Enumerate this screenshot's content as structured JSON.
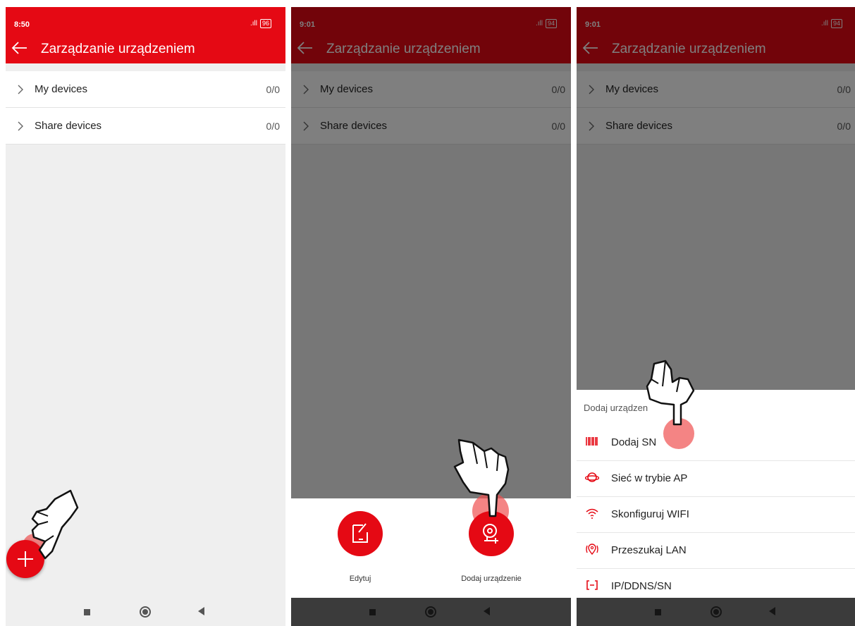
{
  "screens": [
    {
      "time": "8:50",
      "battery": "96",
      "title": "Zarządzanie urządzeniem",
      "rows": [
        {
          "label": "My devices",
          "count": "0/0"
        },
        {
          "label": "Share devices",
          "count": "0/0"
        }
      ]
    },
    {
      "time": "9:01",
      "battery": "94",
      "title": "Zarządzanie urządzeniem",
      "rows": [
        {
          "label": "My devices",
          "count": "0/0"
        },
        {
          "label": "Share devices",
          "count": "0/0"
        }
      ],
      "sheet": {
        "edit_label": "Edytuj",
        "add_label": "Dodaj urządzenie"
      }
    },
    {
      "time": "9:01",
      "battery": "94",
      "title": "Zarządzanie urządzeniem",
      "rows": [
        {
          "label": "My devices",
          "count": "0/0"
        },
        {
          "label": "Share devices",
          "count": "0/0"
        }
      ],
      "sheet": {
        "title": "Dodaj urządzen",
        "options": [
          {
            "label": "Dodaj SN",
            "icon": "barcode-icon"
          },
          {
            "label": "Sieć w trybie AP",
            "icon": "planet-icon"
          },
          {
            "label": "Skonfiguruj WIFI",
            "icon": "wifi-icon"
          },
          {
            "label": "Przeszukaj LAN",
            "icon": "location-pin-icon"
          },
          {
            "label": "IP/DDNS/SN",
            "icon": "ip-box-icon"
          }
        ]
      }
    }
  ],
  "colors": {
    "accent": "#e50914",
    "background": "#efefef",
    "touch": "#f05050"
  }
}
